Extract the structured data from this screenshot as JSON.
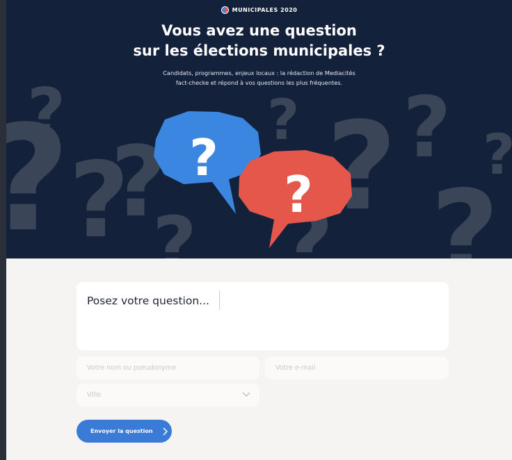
{
  "header": {
    "badge_label": "MUNICIPALES 2020",
    "title_line1": "Vous avez une question",
    "title_line2": "sur les élections municipales ?",
    "subtitle_line1": "Candidats, programmes, enjeux locaux : la rédaction de Mediacités",
    "subtitle_line2": "fact-checke et répond à vos questions les plus fréquentes."
  },
  "illustration": {
    "bubble_left_glyph": "?",
    "bubble_right_glyph": "?",
    "colors": {
      "background": "#14213a",
      "bubble_left": "#3b86e0",
      "bubble_right": "#e4574a",
      "shadow_marks": "#3a4558"
    }
  },
  "form": {
    "question_placeholder": "Posez votre question...",
    "name_placeholder": "Votre nom ou pseudonyme",
    "email_placeholder": "Votre e-mail",
    "city_placeholder": "Ville",
    "submit_label": "Envoyer la question",
    "icons": {
      "city_dropdown": "chevron-down-icon",
      "submit": "chevron-right-icon"
    },
    "colors": {
      "background": "#f5f4f2",
      "submit": "#3a7bd8"
    }
  }
}
